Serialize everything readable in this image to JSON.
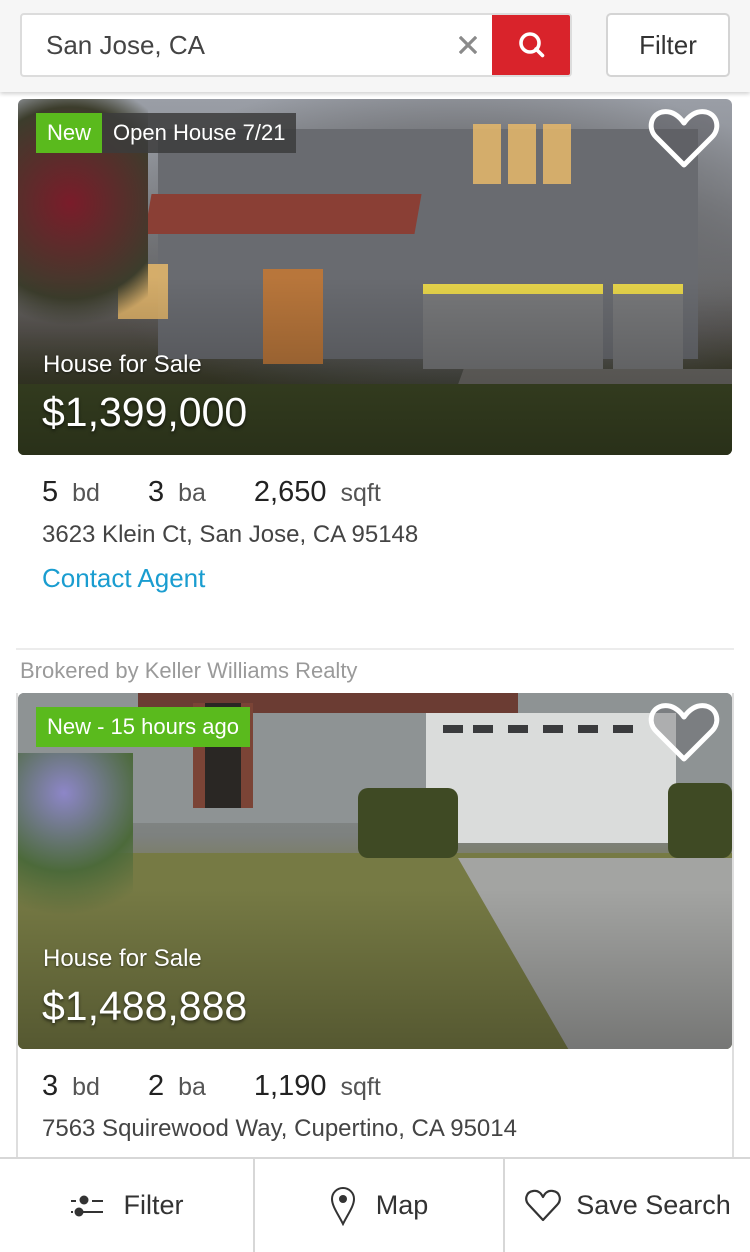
{
  "search": {
    "value": "San Jose, CA",
    "clear_icon": "close-icon",
    "search_icon": "search-icon",
    "filter_label": "Filter"
  },
  "colors": {
    "brand_red": "#d9232b",
    "badge_green": "#5aba1d",
    "link_blue": "#1a9dd0"
  },
  "listings": [
    {
      "badges": [
        "New",
        "Open House 7/21"
      ],
      "favorite_icon": "heart-outline-icon",
      "type": "House for Sale",
      "price": "$1,399,000",
      "beds": "5",
      "beds_unit": "bd",
      "baths": "3",
      "baths_unit": "ba",
      "sqft": "2,650",
      "sqft_unit": "sqft",
      "address": "3623 Klein Ct, San Jose, CA 95148",
      "contact_label": "Contact Agent"
    },
    {
      "brokered_by": "Brokered by Keller Williams Realty",
      "badges": [
        "New - 15 hours ago"
      ],
      "favorite_icon": "heart-outline-icon",
      "type": "House for Sale",
      "price": "$1,488,888",
      "beds": "3",
      "beds_unit": "bd",
      "baths": "2",
      "baths_unit": "ba",
      "sqft": "1,190",
      "sqft_unit": "sqft",
      "address": "7563 Squirewood Way, Cupertino, CA 95014"
    }
  ],
  "bottom_nav": [
    {
      "label": "Filter",
      "icon": "sliders-icon"
    },
    {
      "label": "Map",
      "icon": "map-pin-icon"
    },
    {
      "label": "Save Search",
      "icon": "heart-outline-icon"
    }
  ]
}
